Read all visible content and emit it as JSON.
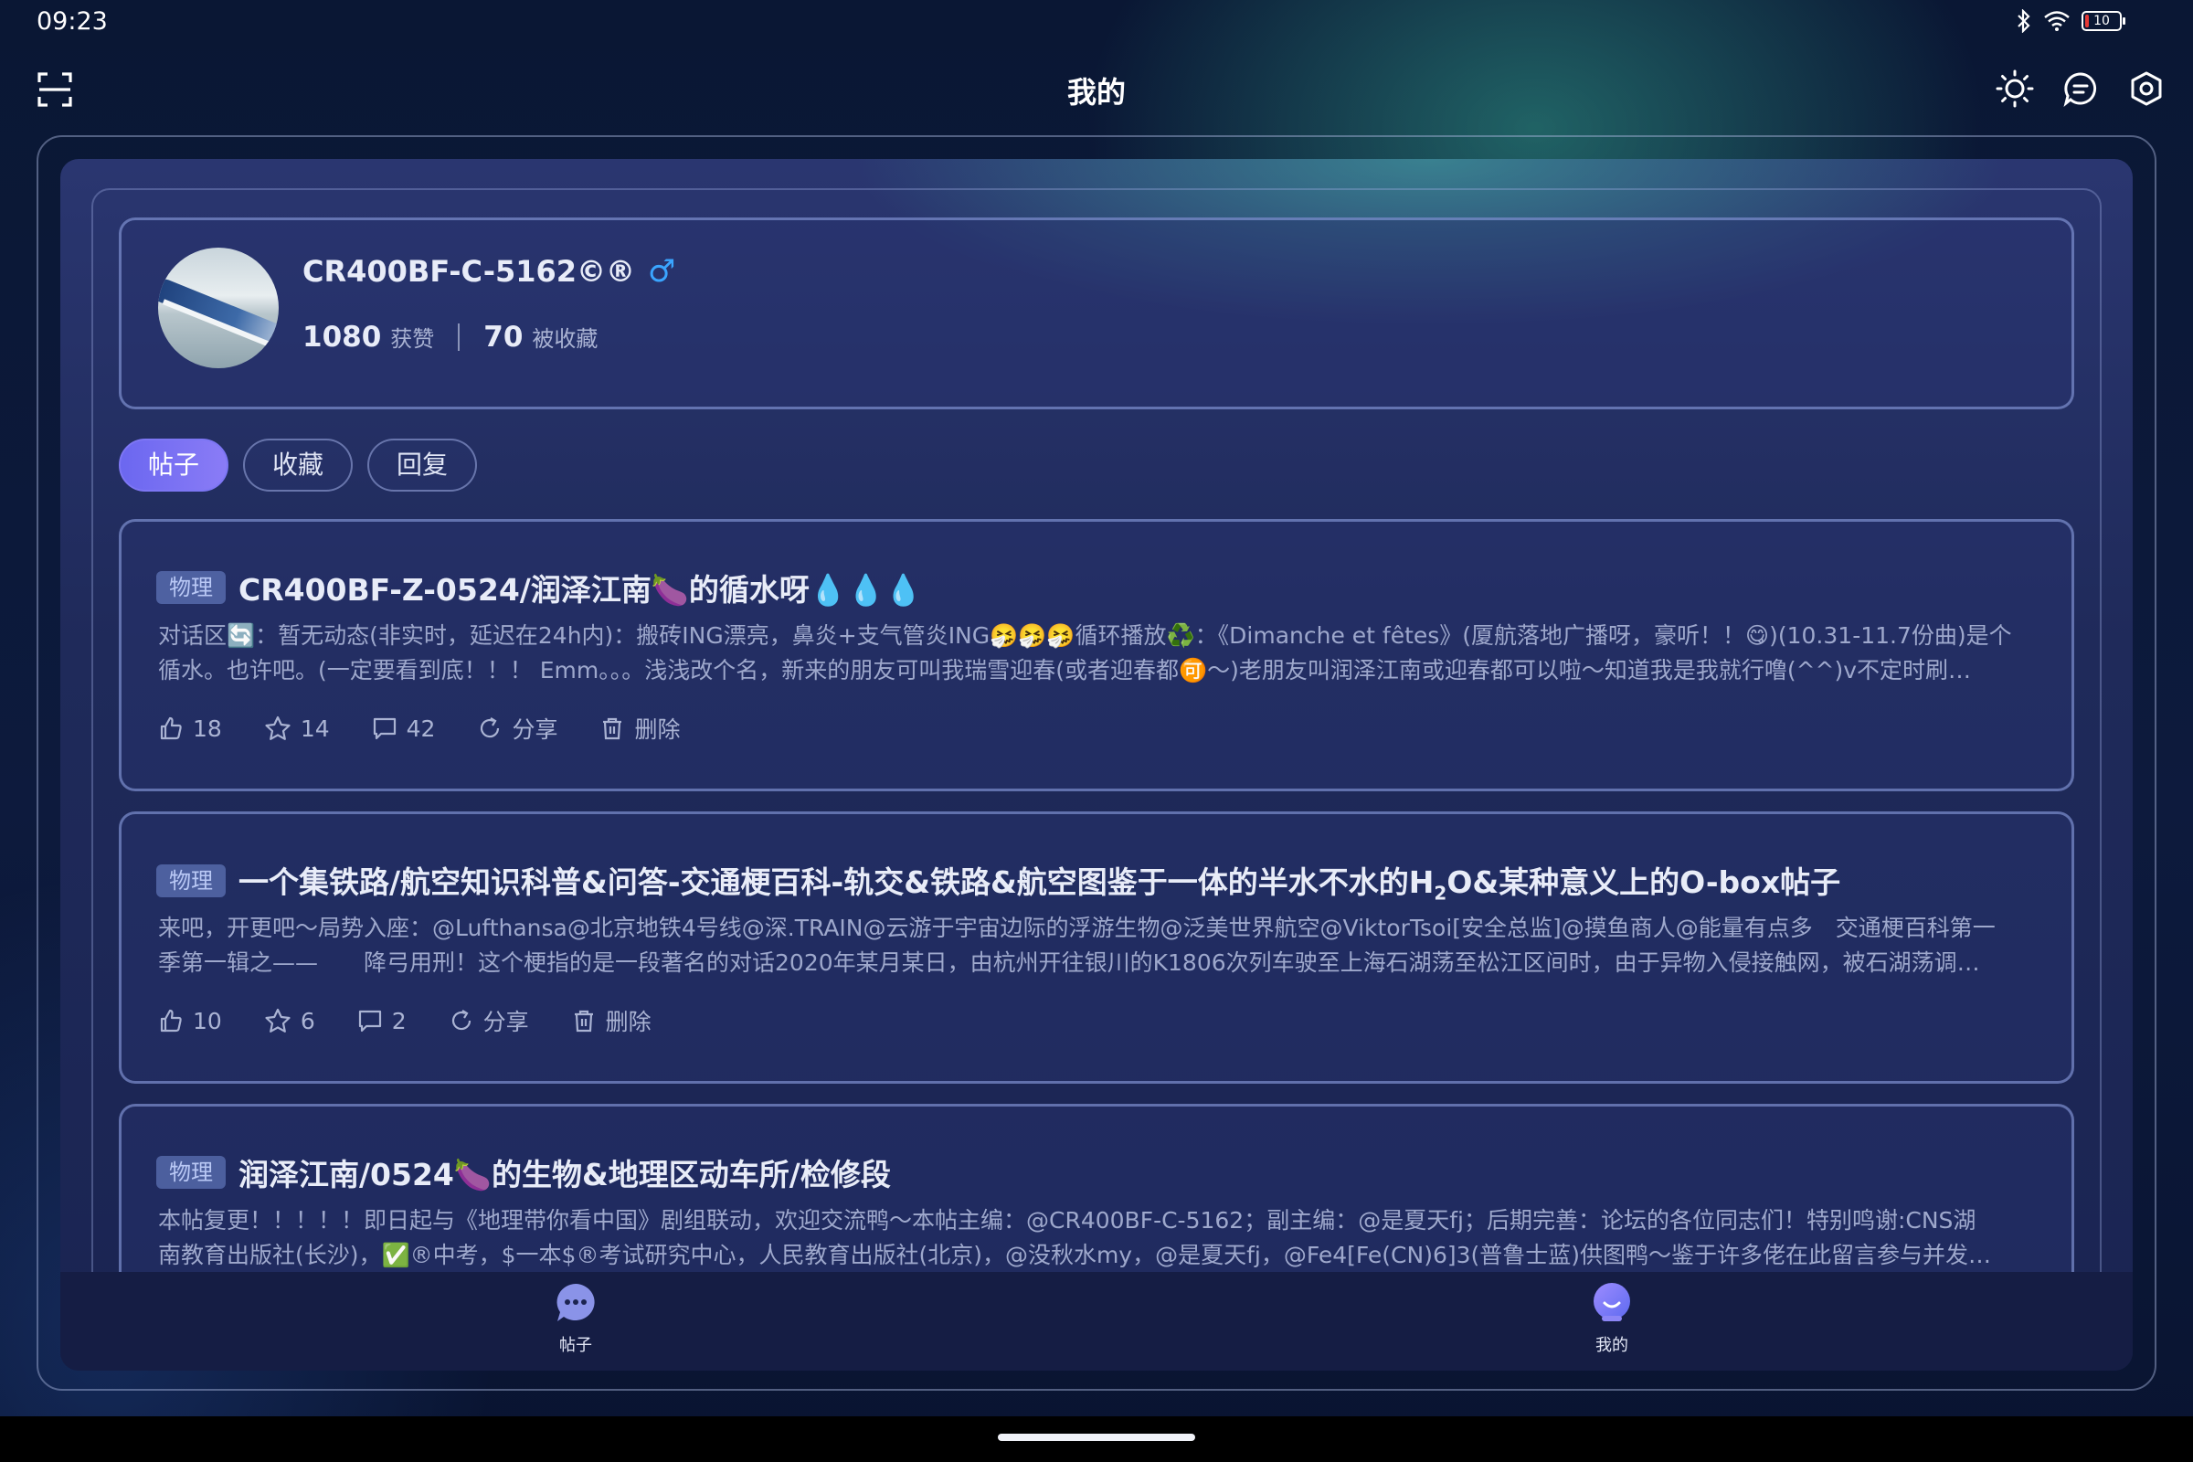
{
  "status_bar": {
    "time": "09:23",
    "battery_level": "10"
  },
  "header": {
    "title": "我的"
  },
  "icons": {
    "scan": "scan-icon",
    "theme": "sun-icon",
    "messages": "chat-bubble-icon",
    "settings": "settings-icon"
  },
  "profile": {
    "username": "CR400BF-C-5162©®",
    "gender_symbol": "♂",
    "likes_count": "1080",
    "likes_label": "获赞",
    "favorited_count": "70",
    "favorited_label": "被收藏"
  },
  "tabs": [
    {
      "label": "帖子",
      "active": true
    },
    {
      "label": "收藏",
      "active": false
    },
    {
      "label": "回复",
      "active": false
    }
  ],
  "posts": [
    {
      "tag": "物理",
      "title": "CR400BF-Z-0524/润泽江南🍆的循水呀💧💧💧",
      "line1": "对话区🔄：暂无动态(非实时，延迟在24h内)：搬砖ING漂亮，鼻炎+支气管炎ING🤧🤧🤧循环播放♻️：《Dimanche et fêtes》(厦航落地广播呀，豪听！！😋)(10.31-11.7份曲)是个",
      "line2": "循水。也许吧。(一定要看到底！！！ Emm。。。浅浅改个名，新来的朋友可叫我瑞雪迎春(或者迎春都🉑～)老朋友叫润泽江南或迎春都可以啦～知道我是我就行噜(^^)v不定时刷…",
      "likes": "18",
      "stars": "14",
      "comments": "42",
      "share_label": "分享",
      "delete_label": "删除"
    },
    {
      "tag": "物理",
      "title_pre": "一个集铁路/航空知识科普&问答-交通梗百科-轨交&铁路&航空图鉴于一体的半水不水的H",
      "title_sub": "2",
      "title_post": "O&某种意义上的O-box帖子",
      "line1": "来吧，开更吧～局势入座：@Lufthansa@北京地铁4号线@深.TRAIN@云游于宇宙边际的浮游生物@泛美世界航空@ViktorTsoi[安全总监]@摸鱼商人@能量有点多　交通梗百科第一",
      "line2": "季第一辑之——　　降弓用刑！这个梗指的是一段著名的对话2020年某月某日，由杭州开往银川的K1806次列车驶至上海石湖荡至松江区间时，由于异物入侵接触网，被石湖荡调…",
      "likes": "10",
      "stars": "6",
      "comments": "2",
      "share_label": "分享",
      "delete_label": "删除"
    },
    {
      "tag": "物理",
      "title": "润泽江南/0524🍆的生物&地理区动车所/检修段",
      "line1": "本帖复更！！！！！即日起与《地理带你看中国》剧组联动，欢迎交流鸭～本帖主编：@CR400BF-C-5162；副主编：@是夏天fj；后期完善：论坛的各位同志们！特别鸣谢:CNS湖",
      "line2": "南教育出版社(长沙)，✅®中考，$一本$®考试研究中心，人民教育出版社(北京)，@没秋水my，@是夏天fj，@Fe4[Fe(CN)6]3(普鲁士蓝)供图鸭～鉴于许多佬在此留言参与并发…"
    }
  ],
  "bottom_nav": [
    {
      "label": "帖子",
      "icon": "chat-dots-icon"
    },
    {
      "label": "我的",
      "icon": "user-face-icon"
    }
  ],
  "colors": {
    "accent": "#7a74f3",
    "gender": "#3aa5ff"
  }
}
